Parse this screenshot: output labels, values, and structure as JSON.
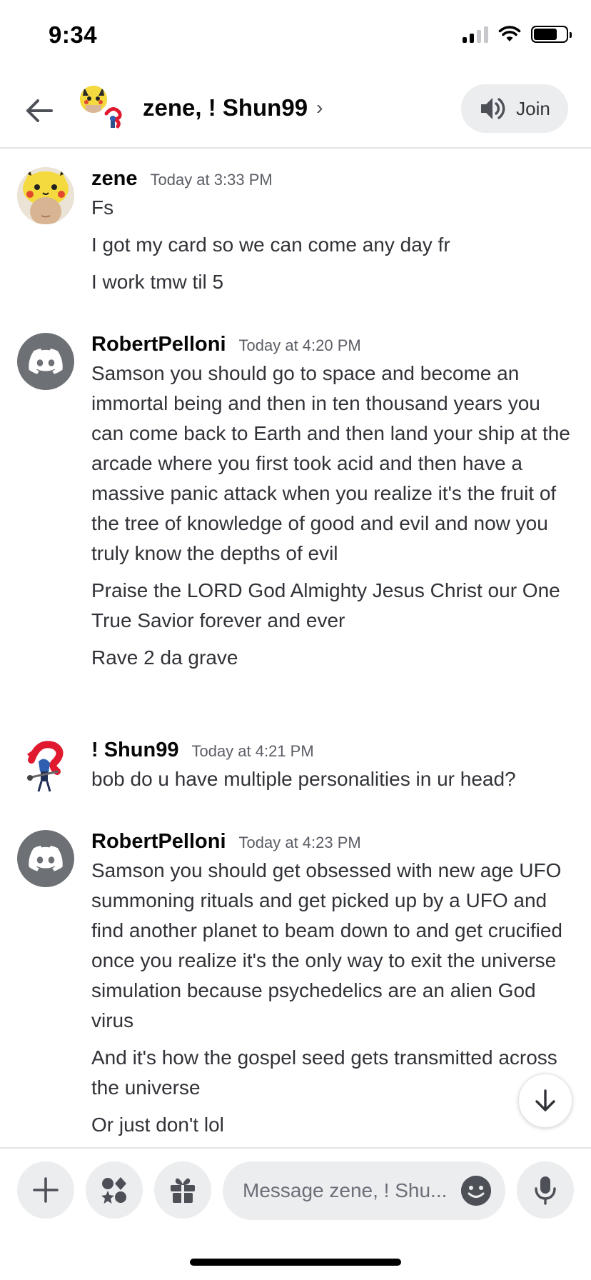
{
  "status_bar": {
    "time": "9:34"
  },
  "header": {
    "title": "zene, ! Shun99",
    "chevron": "›",
    "join_label": "Join",
    "back_icon": "arrow-left-icon",
    "join_icon": "speaker-icon"
  },
  "messages": [
    {
      "author": "zene",
      "timestamp": "Today at 3:33 PM",
      "avatar": "pikachu-hat-avatar",
      "lines": [
        "Fs",
        "I got my card so we can come any day fr",
        "I work tmw til 5"
      ]
    },
    {
      "author": "RobertPelloni",
      "timestamp": "Today at 4:20 PM",
      "avatar": "discord-default-avatar",
      "lines": [
        "Samson you should go to space and become an immortal being and then in ten thousand years you can come back to Earth and then land your ship at the arcade where you first took acid and then have a massive panic attack when you realize it's the fruit of the tree of knowledge of good and evil and now you truly know the depths of evil",
        "Praise the LORD God Almighty Jesus Christ our One True Savior forever and ever",
        "Rave 2 da grave"
      ]
    },
    {
      "author": "! Shun99",
      "timestamp": "Today at 4:21 PM",
      "avatar": "anime-character-avatar",
      "lines": [
        "bob do u have multiple personalities in ur head?"
      ]
    },
    {
      "author": "RobertPelloni",
      "timestamp": "Today at 4:23 PM",
      "avatar": "discord-default-avatar",
      "lines": [
        "Samson you should get obsessed with new age UFO summoning rituals and get picked up by a UFO and find another planet to beam down to and get crucified once you realize it's the only way to exit the universe simulation because psychedelics are an alien God virus",
        "And it's how the gospel seed gets transmitted across the universe",
        "Or just don't lol"
      ]
    }
  ],
  "composer": {
    "placeholder": "Message zene, ! Shu...",
    "icons": [
      "plus-icon",
      "apps-icon",
      "gift-icon",
      "emoji-icon",
      "microphone-icon"
    ]
  },
  "colors": {
    "background": "#ffffff",
    "button_bg": "#ebedef",
    "discord_avatar": "#6d7075",
    "text": "#313338",
    "timestamp": "#5c5e66"
  }
}
